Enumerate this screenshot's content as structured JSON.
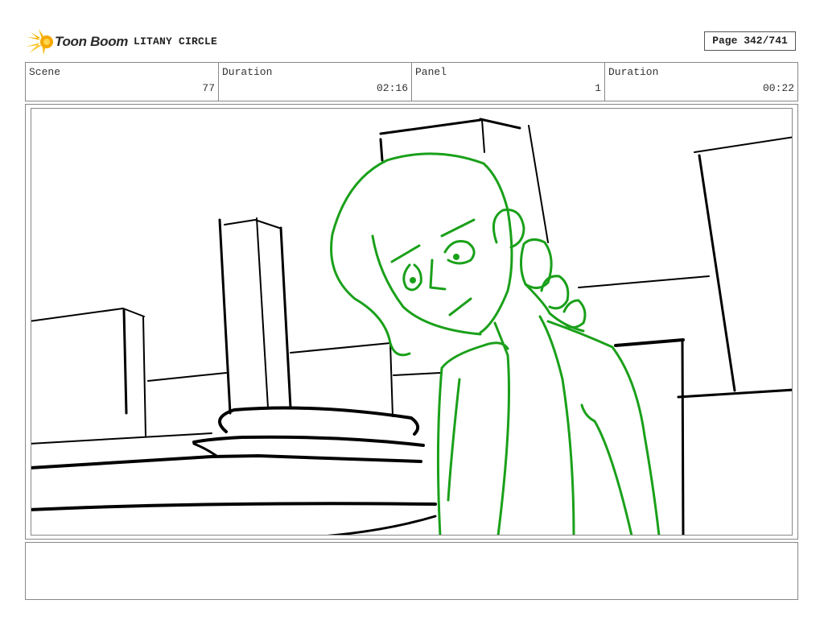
{
  "header": {
    "logo_text": "Toon Boom",
    "logo_icon": "toon-boom-starburst-icon",
    "project_title": "LITANY CIRCLE",
    "page_label": "Page 342/741"
  },
  "info": {
    "scene_label": "Scene",
    "scene_value": "77",
    "scene_duration_label": "Duration",
    "scene_duration_value": "02:16",
    "panel_label": "Panel",
    "panel_value": "1",
    "panel_duration_label": "Duration",
    "panel_duration_value": "00:22"
  },
  "notes": {
    "text": ""
  },
  "colors": {
    "sketch_line": "#000000",
    "character_line": "#1aa01a",
    "border": "#888888"
  }
}
